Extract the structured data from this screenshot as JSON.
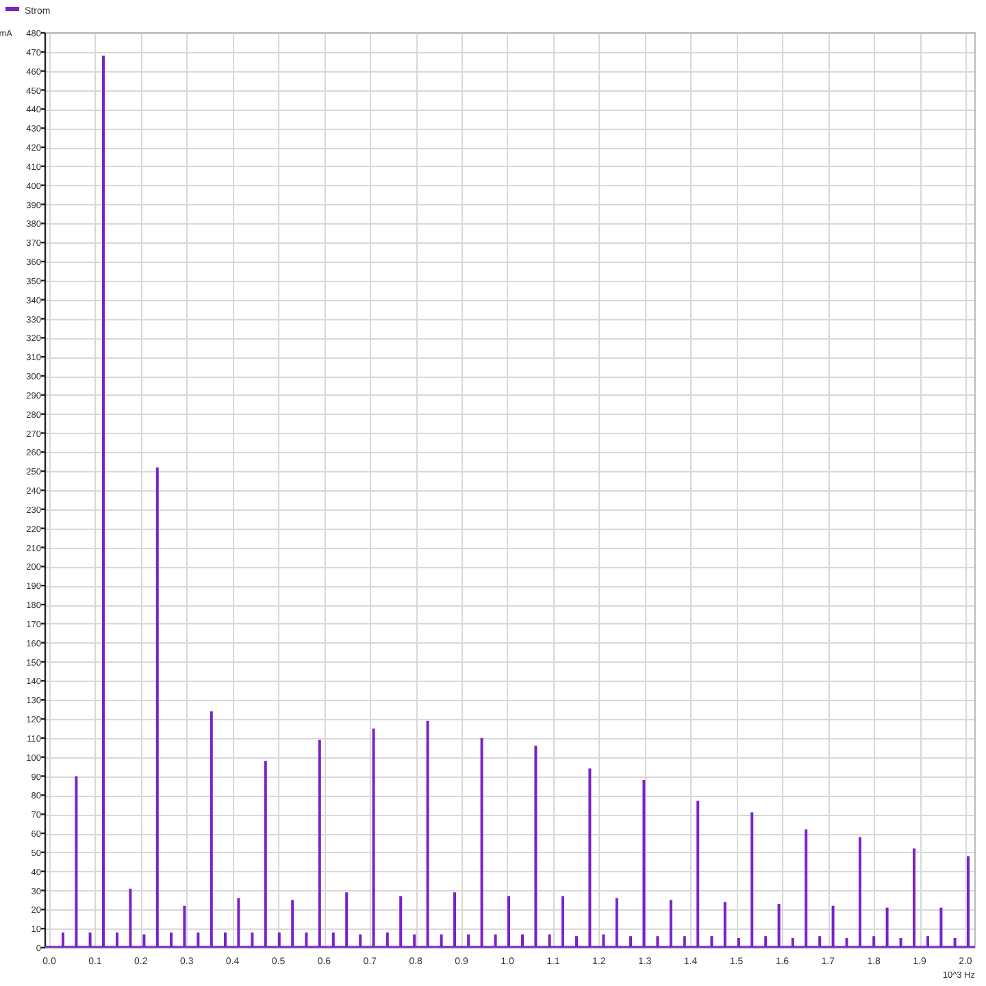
{
  "chart": {
    "chart_data": {
      "type": "bar",
      "ylabel": "mA",
      "xlabel": "10^3 Hz",
      "xlim": [
        -0.009,
        2.021
      ],
      "ylim": [
        0,
        480
      ],
      "x": [
        0.03,
        0.059,
        0.089,
        0.118,
        0.148,
        0.177,
        0.207,
        0.236,
        0.266,
        0.295,
        0.325,
        0.354,
        0.384,
        0.413,
        0.443,
        0.472,
        0.502,
        0.531,
        0.561,
        0.59,
        0.62,
        0.649,
        0.679,
        0.708,
        0.738,
        0.767,
        0.797,
        0.826,
        0.856,
        0.885,
        0.915,
        0.944,
        0.974,
        1.003,
        1.033,
        1.062,
        1.092,
        1.121,
        1.151,
        1.18,
        1.21,
        1.239,
        1.269,
        1.298,
        1.328,
        1.357,
        1.387,
        1.416,
        1.446,
        1.475,
        1.505,
        1.534,
        1.564,
        1.593,
        1.623,
        1.652,
        1.682,
        1.711,
        1.741,
        1.77,
        1.8,
        1.829,
        1.859,
        1.888,
        1.918,
        1.947,
        1.977,
        2.006
      ],
      "series": [
        {
          "name": "Strom",
          "color": "#7a22c9",
          "values": [
            8,
            90,
            8,
            468,
            8,
            31,
            7,
            252,
            8,
            22,
            8,
            124,
            8,
            26,
            8,
            98,
            8,
            25,
            8,
            109,
            8,
            29,
            7,
            115,
            8,
            27,
            7,
            119,
            7,
            29,
            7,
            110,
            7,
            27,
            7,
            106,
            7,
            27,
            6,
            94,
            7,
            26,
            6,
            88,
            6,
            25,
            6,
            77,
            6,
            24,
            5,
            71,
            6,
            23,
            5,
            62,
            6,
            22,
            5,
            58,
            6,
            21,
            5,
            52,
            6,
            21,
            5,
            48
          ]
        }
      ],
      "xticks": [
        {
          "value": 0,
          "label": "0.0"
        },
        {
          "value": 0.1,
          "label": "0.1"
        },
        {
          "value": 0.2,
          "label": "0.2"
        },
        {
          "value": 0.3,
          "label": "0.3"
        },
        {
          "value": 0.4,
          "label": "0.4"
        },
        {
          "value": 0.5,
          "label": "0.5"
        },
        {
          "value": 0.6,
          "label": "0.6"
        },
        {
          "value": 0.7,
          "label": "0.7"
        },
        {
          "value": 0.8,
          "label": "0.8"
        },
        {
          "value": 0.9,
          "label": "0.9"
        },
        {
          "value": 1,
          "label": "1.0"
        },
        {
          "value": 1.1,
          "label": "1.1"
        },
        {
          "value": 1.2,
          "label": "1.2"
        },
        {
          "value": 1.3,
          "label": "1.3"
        },
        {
          "value": 1.4,
          "label": "1.4"
        },
        {
          "value": 1.5,
          "label": "1.5"
        },
        {
          "value": 1.6,
          "label": "1.6"
        },
        {
          "value": 1.7,
          "label": "1.7"
        },
        {
          "value": 1.8,
          "label": "1.8"
        },
        {
          "value": 1.9,
          "label": "1.9"
        },
        {
          "value": 2,
          "label": "2.0"
        }
      ],
      "yticks": [
        0,
        10,
        20,
        30,
        40,
        50,
        60,
        70,
        80,
        90,
        100,
        110,
        120,
        130,
        140,
        150,
        160,
        170,
        180,
        190,
        200,
        210,
        220,
        230,
        240,
        250,
        260,
        270,
        280,
        290,
        300,
        310,
        320,
        330,
        340,
        350,
        360,
        370,
        380,
        390,
        400,
        410,
        420,
        430,
        440,
        450,
        460,
        470,
        480
      ]
    }
  }
}
